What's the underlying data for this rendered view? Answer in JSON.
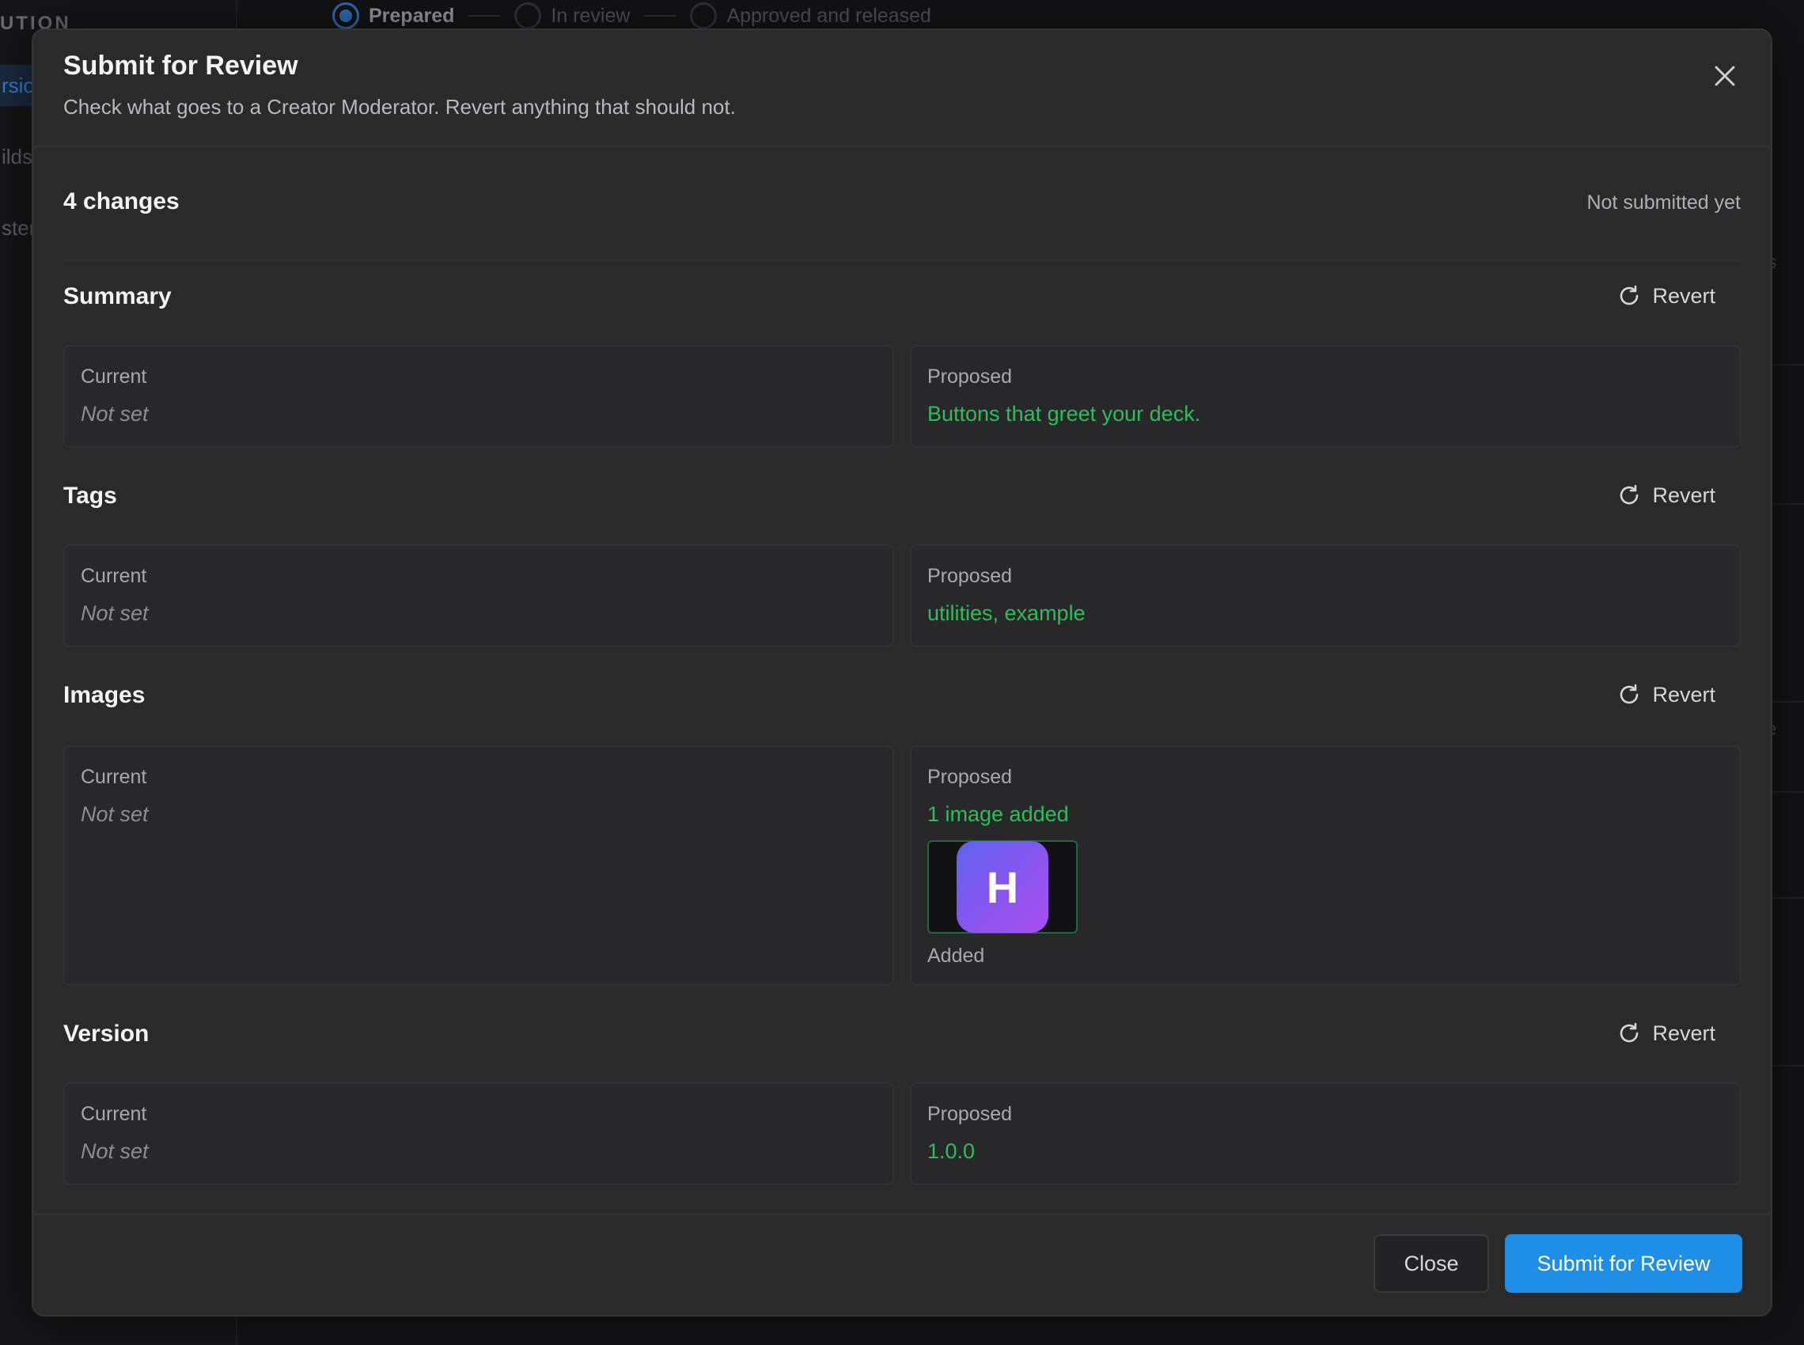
{
  "background": {
    "sidebar": {
      "section_fragment": "UTION",
      "items": [
        {
          "label": "rsio",
          "active": true
        },
        {
          "label": "ilds",
          "active": false
        },
        {
          "label": "ster",
          "active": false
        }
      ]
    },
    "stepper": {
      "steps": [
        {
          "label": "Prepared",
          "active": true
        },
        {
          "label": "In review",
          "active": false
        },
        {
          "label": "Approved and released",
          "active": false
        }
      ]
    },
    "right_fragments": [
      "es",
      "ve"
    ]
  },
  "modal": {
    "title": "Submit for Review",
    "subtitle": "Check what goes to a Creator Moderator. Revert anything that should not.",
    "close_icon": "close-icon",
    "changes_count": "4 changes",
    "status": "Not submitted yet",
    "revert_label": "Revert",
    "current_label": "Current",
    "proposed_label": "Proposed",
    "sections": [
      {
        "title": "Summary",
        "current": "Not set",
        "proposed": "Buttons that greet your deck."
      },
      {
        "title": "Tags",
        "current": "Not set",
        "proposed": "utilities, example"
      },
      {
        "title": "Images",
        "current": "Not set",
        "proposed": "1 image added",
        "image_letter": "H",
        "image_caption": "Added"
      },
      {
        "title": "Version",
        "current": "Not set",
        "proposed": "1.0.0"
      }
    ],
    "footer": {
      "close_label": "Close",
      "submit_label": "Submit for Review"
    }
  },
  "colors": {
    "accent": "#1f8ee6",
    "proposed_text": "#2ebd59",
    "modal_bg": "#2a2a2b"
  }
}
